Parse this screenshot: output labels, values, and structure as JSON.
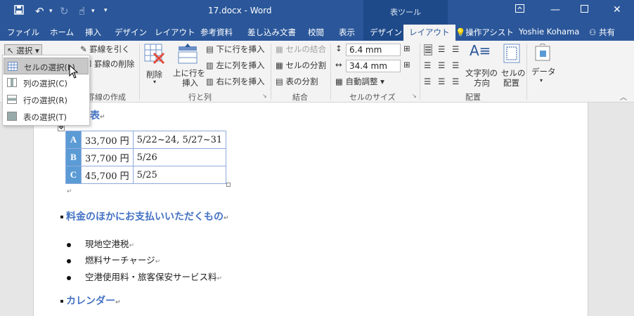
{
  "title": {
    "document": "17.docx - Word",
    "context_tab_group": "表ツール"
  },
  "tabs": [
    "ファイル",
    "ホーム",
    "挿入",
    "デザイン",
    "レイアウト",
    "参考資料",
    "差し込み文書",
    "校閲",
    "表示",
    "デザイン",
    "レイアウト"
  ],
  "tell_me": "操作アシスト",
  "user": "Yoshie Kohama",
  "share": "共有",
  "ribbon": {
    "select": "選択",
    "draw_border": "罫線を引く",
    "erase_border": "罫線の削除",
    "draw_group": "罫線の作成",
    "delete": "削除",
    "insert_above": "上に行を",
    "insert_above2": "挿入",
    "insert_below": "下に行を挿入",
    "insert_left": "左に列を挿入",
    "insert_right": "右に列を挿入",
    "rows_cols_group": "行と列",
    "merge_cells": "セルの結合",
    "split_cells": "セルの分割",
    "split_table": "表の分割",
    "merge_group": "結合",
    "height": "6.4 mm",
    "width": "34.4 mm",
    "autofit": "自動調整",
    "cell_size_group": "セルのサイズ",
    "text_direction": "文字列の",
    "text_direction2": "方向",
    "cell_margins": "セルの",
    "cell_margins2": "配置",
    "alignment_group": "配置",
    "data": "データ"
  },
  "select_menu": {
    "items": [
      "セルの選択(L)",
      "列の選択(C)",
      "行の選択(R)",
      "表の選択(T)"
    ],
    "highlighted": 0
  },
  "document": {
    "table_title": "表",
    "table": [
      [
        "A",
        "33,700 円",
        "5/22~24, 5/27~31"
      ],
      [
        "B",
        "37,700 円",
        "5/26"
      ],
      [
        "C",
        "45,700 円",
        "5/25"
      ]
    ],
    "heading2": "料金のほかにお支払いいただくもの",
    "bullets": [
      "現地空港税",
      "燃料サーチャージ",
      "空港使用料・旅客保安サービス料"
    ],
    "heading3": "カレンダー"
  },
  "colors": {
    "titlebar": "#2b579a",
    "context_tab": "#1e4a8a",
    "table_header": "#5b9bd5",
    "heading": "#4472c4"
  }
}
